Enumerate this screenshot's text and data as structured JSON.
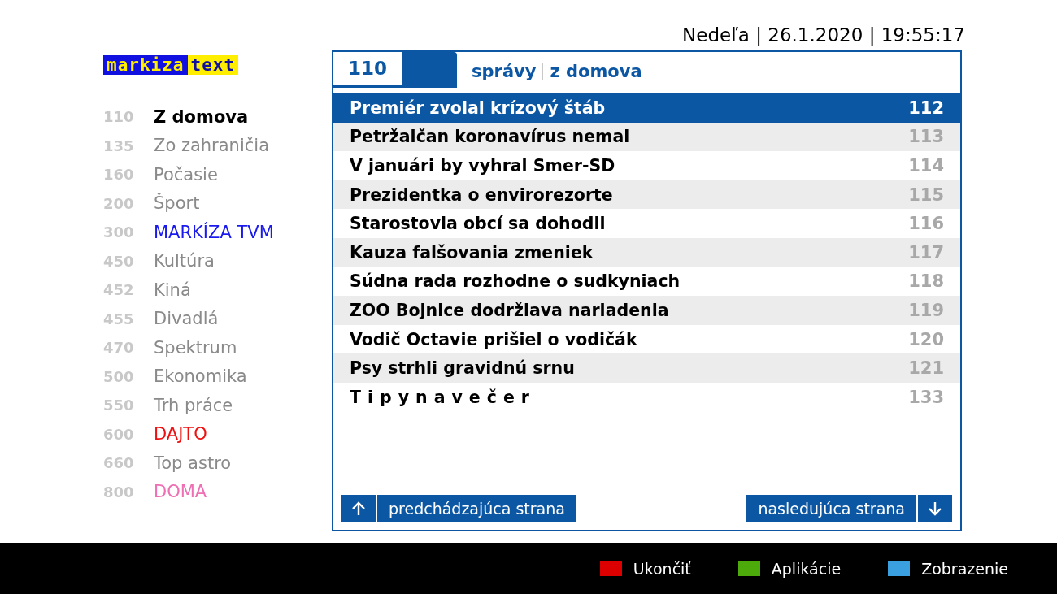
{
  "header": {
    "datetime": "Nedeľa | 26.1.2020 | 19:55:17"
  },
  "logo": {
    "left": "markiza",
    "right": "text"
  },
  "sidebar": {
    "items": [
      {
        "page": "110",
        "label": "Z domova",
        "selected": true,
        "color": "#000000"
      },
      {
        "page": "135",
        "label": "Zo zahraničia",
        "selected": false,
        "color": "#8a8a8a"
      },
      {
        "page": "160",
        "label": "Počasie",
        "selected": false,
        "color": "#8a8a8a"
      },
      {
        "page": "200",
        "label": "Šport",
        "selected": false,
        "color": "#8a8a8a"
      },
      {
        "page": "300",
        "label": "MARKÍZA TVM",
        "selected": false,
        "color": "#1a1aee"
      },
      {
        "page": "450",
        "label": "Kultúra",
        "selected": false,
        "color": "#8a8a8a"
      },
      {
        "page": "452",
        "label": "Kiná",
        "selected": false,
        "color": "#8a8a8a"
      },
      {
        "page": "455",
        "label": "Divadlá",
        "selected": false,
        "color": "#8a8a8a"
      },
      {
        "page": "470",
        "label": "Spektrum",
        "selected": false,
        "color": "#8a8a8a"
      },
      {
        "page": "500",
        "label": "Ekonomika",
        "selected": false,
        "color": "#8a8a8a"
      },
      {
        "page": "550",
        "label": "Trh práce",
        "selected": false,
        "color": "#8a8a8a"
      },
      {
        "page": "600",
        "label": "DAJTO",
        "selected": false,
        "color": "#ee1111"
      },
      {
        "page": "660",
        "label": "Top astro",
        "selected": false,
        "color": "#8a8a8a"
      },
      {
        "page": "800",
        "label": "DOMA",
        "selected": false,
        "color": "#ee6fb4"
      }
    ]
  },
  "panel": {
    "page": "110",
    "section": "správy",
    "subsection": "z domova",
    "rows": [
      {
        "kind": "headline",
        "title": "Premiér zvolal krízový štáb",
        "page": "112",
        "selected": true
      },
      {
        "kind": "headline",
        "title": "Petržalčan koronavírus nemal",
        "page": "113",
        "selected": false
      },
      {
        "kind": "headline",
        "title": "V januári by vyhral Smer-SD",
        "page": "114",
        "selected": false
      },
      {
        "kind": "headline",
        "title": "Prezidentka o envirorezorte",
        "page": "115",
        "selected": false
      },
      {
        "kind": "headline",
        "title": "Starostovia obcí sa dohodli",
        "page": "116",
        "selected": false
      },
      {
        "kind": "headline",
        "title": "Kauza falšovania zmeniek",
        "page": "117",
        "selected": false
      },
      {
        "kind": "headline",
        "title": "Súdna rada rozhodne o sudkyniach",
        "page": "118",
        "selected": false
      },
      {
        "kind": "headline",
        "title": "ZOO Bojnice dodržiava nariadenia",
        "page": "119",
        "selected": false
      },
      {
        "kind": "headline",
        "title": "Vodič Octavie prišiel o vodičák",
        "page": "120",
        "selected": false
      },
      {
        "kind": "headline",
        "title": "Psy strhli gravidnú srnu",
        "page": "121",
        "selected": false
      },
      {
        "kind": "spaced",
        "title": "Tipynavečer",
        "page": "133",
        "selected": false
      }
    ],
    "prev": "predchádzajúca strana",
    "next": "nasledujúca strana"
  },
  "footer": {
    "keys": [
      {
        "label": "Ukončiť",
        "color": "#dd0000"
      },
      {
        "label": "Aplikácie",
        "color": "#4caa0a"
      },
      {
        "label": "Zobrazenie",
        "color": "#3aa0e0"
      }
    ]
  }
}
